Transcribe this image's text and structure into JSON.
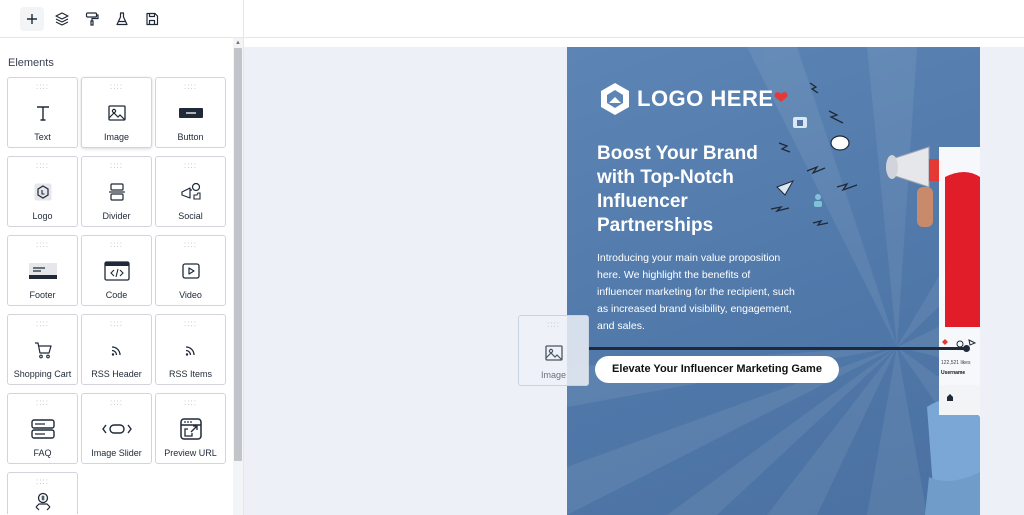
{
  "sidebar": {
    "title": "Elements",
    "items": [
      {
        "label": "Text",
        "icon": "text-icon"
      },
      {
        "label": "Image",
        "icon": "image-icon"
      },
      {
        "label": "Button",
        "icon": "button-icon"
      },
      {
        "label": "Logo",
        "icon": "logo-icon"
      },
      {
        "label": "Divider",
        "icon": "divider-icon"
      },
      {
        "label": "Social",
        "icon": "social-icon"
      },
      {
        "label": "Footer",
        "icon": "footer-icon"
      },
      {
        "label": "Code",
        "icon": "code-icon"
      },
      {
        "label": "Video",
        "icon": "video-icon"
      },
      {
        "label": "Shopping Cart",
        "icon": "cart-icon"
      },
      {
        "label": "RSS Header",
        "icon": "rss-icon"
      },
      {
        "label": "RSS Items",
        "icon": "rss-icon"
      },
      {
        "label": "FAQ",
        "icon": "faq-icon"
      },
      {
        "label": "Image Slider",
        "icon": "slider-icon"
      },
      {
        "label": "Preview URL",
        "icon": "preview-url-icon"
      },
      {
        "label": "",
        "icon": "money-icon"
      }
    ]
  },
  "toolbar": {
    "icons": [
      "plus-icon",
      "layers-icon",
      "paint-roller-icon",
      "flask-icon",
      "save-icon"
    ]
  },
  "drag": {
    "label": "Image"
  },
  "email": {
    "logo_text": "LOGO HERE",
    "headline": "Boost Your Brand with Top-Notch Influencer Partnerships",
    "body": "Introducing your main value proposition here. We highlight the benefits of influencer marketing for the recipient, such as increased brand visibility, engagement, and sales.",
    "cta": "Elevate Your Influencer Marketing Game",
    "phone_likes": "122,521 likes",
    "phone_username": "Username"
  },
  "colors": {
    "email_bg": "#5c85b5",
    "canvas_bg": "#edf1f7",
    "accent_dark": "#1f2937"
  }
}
